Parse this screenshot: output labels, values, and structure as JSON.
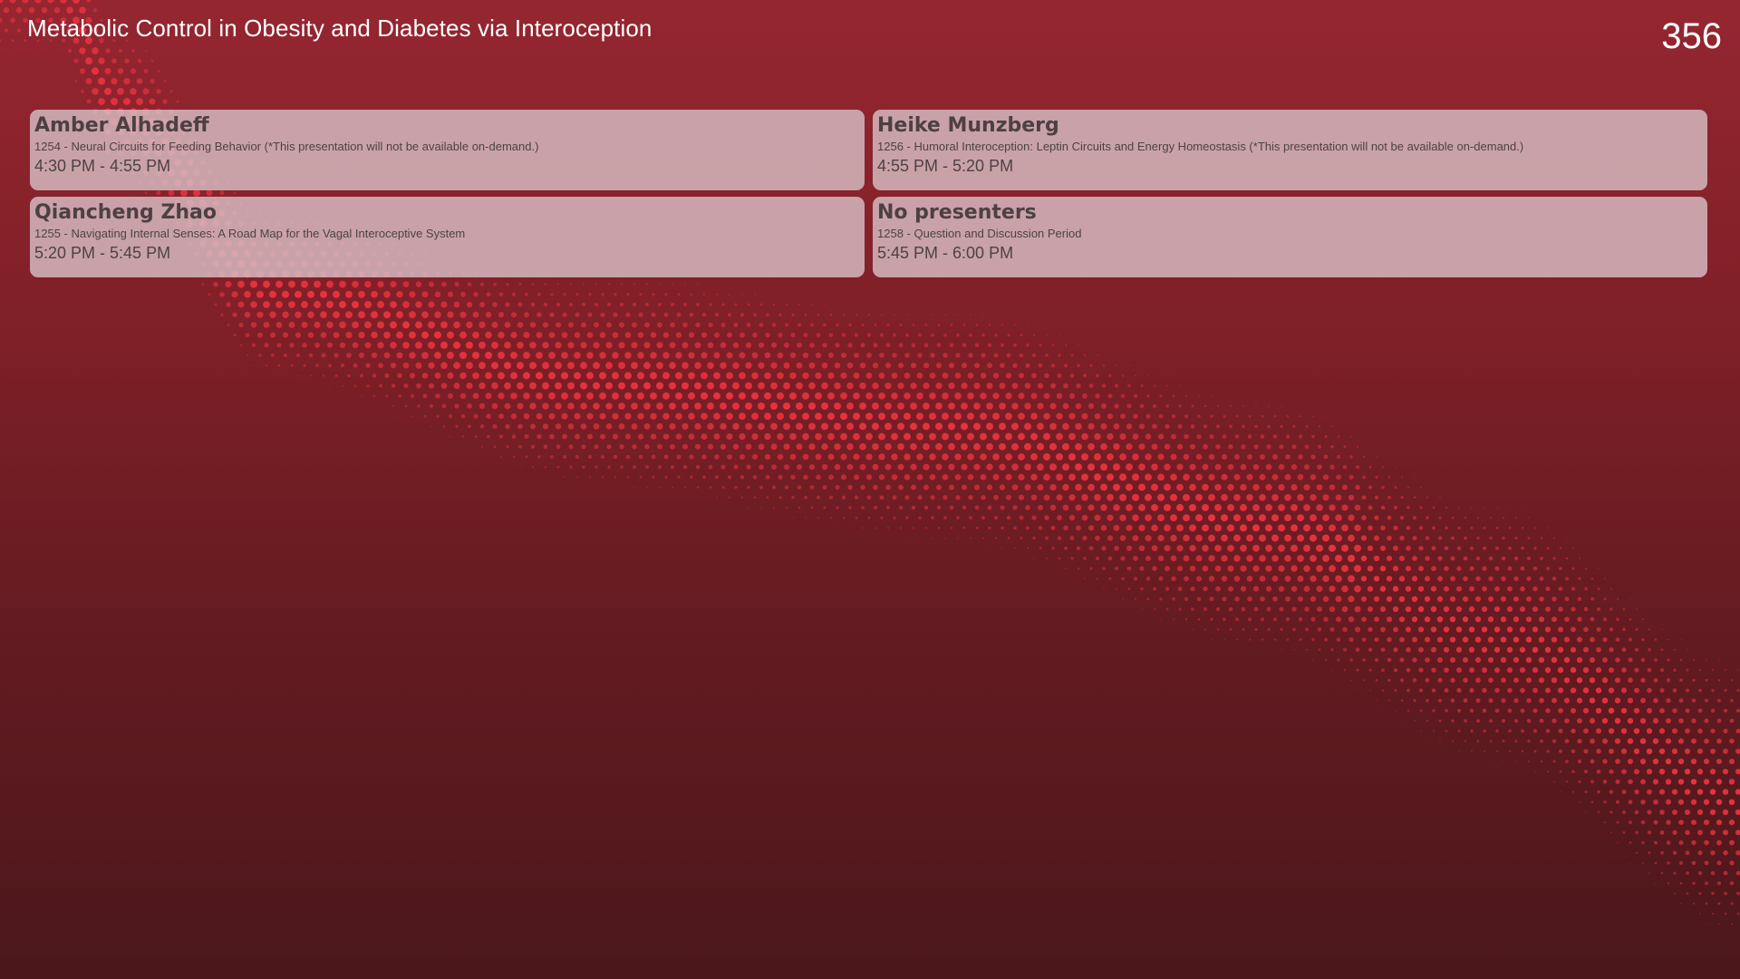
{
  "header": {
    "title": "Metabolic Control in Obesity and Diabetes via Interoception",
    "room": "356"
  },
  "sessions": [
    {
      "presenter": "Amber Alhadeff",
      "description": "1254 - Neural Circuits for Feeding Behavior (*This presentation will not be available on-demand.)",
      "time": "4:30 PM - 4:55 PM"
    },
    {
      "presenter": "Heike Munzberg",
      "description": "1256 - Humoral Interoception: Leptin Circuits and Energy Homeostasis (*This presentation will not be available on-demand.)",
      "time": "4:55 PM - 5:20 PM"
    },
    {
      "presenter": "Qiancheng Zhao",
      "description": "1255 - Navigating Internal Senses: A Road Map for the Vagal Interoceptive System",
      "time": "5:20 PM - 5:45 PM"
    },
    {
      "presenter": "No presenters",
      "description": "1258 - Question and Discussion Period",
      "time": "5:45 PM - 6:00 PM"
    }
  ],
  "colors": {
    "background_top": "#952630",
    "background_bottom": "#4b171b",
    "dot_accent": "#e8323f",
    "card_fill": "#d7bec5",
    "card_text": "#4d4043"
  }
}
